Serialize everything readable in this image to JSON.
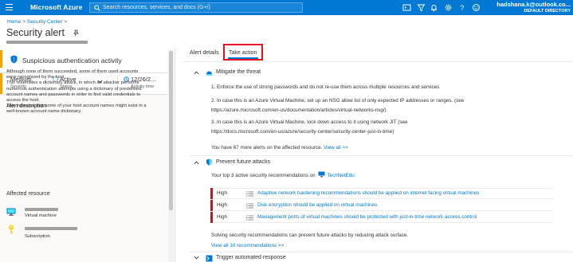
{
  "topbar": {
    "brand": "Microsoft Azure",
    "search_placeholder": "Search resources, services, and docs (G+/)",
    "user_email": "hadshana.k@outlook.co...",
    "user_directory": "DEFAULT DIRECTORY",
    "icons": [
      "cloud-shell-icon",
      "directory-filter-icon",
      "notifications-icon",
      "settings-icon",
      "help-icon",
      "feedback-icon"
    ],
    "bg_color": "#0078d4"
  },
  "breadcrumb": {
    "home": "Home",
    "sep": ">",
    "security_center": "Security Center",
    "sep2": ">"
  },
  "page": {
    "title": "Security alert"
  },
  "alert": {
    "name": "Suspicious authentication activity",
    "severity_value": "Medium",
    "severity_label": "Severity",
    "status_value": "Active",
    "status_label": "Status",
    "time_value": "12/26/2...",
    "time_label": "Activity time",
    "accent_color": "#f0a30a"
  },
  "description": {
    "heading": "Alert description",
    "lines": [
      "Although none of them succeeded, some of them used accounts",
      "were recognized by the host.",
      "This resembles a dictionary attack, in which an attacker performs",
      "numerous authentication attempts using a dictionary of predefined",
      "account names and passwords in order to find valid credentials to",
      "access the host.",
      "This indicates that some of your host account names might exist in a",
      "well-known account name dictionary."
    ]
  },
  "affected": {
    "heading": "Affected resource",
    "items": [
      {
        "type": "Virtual machine",
        "icon": "virtual-machine-icon"
      },
      {
        "type": "Subscription",
        "icon": "key-icon"
      }
    ]
  },
  "tabs": {
    "details": "Alert details",
    "take_action": "Take action"
  },
  "mitigate": {
    "title": "Mitigate the threat",
    "lines": [
      "1. Enforce the use of strong passwords and do not re-use them across multiple resources and services",
      "2. In case this is an Azure Virtual Machine, set up an NSG allow list of only expected IP addresses or ranges. (see",
      "https://azure.microsoft.com/en-us/documentation/articles/virtual-networks-nsg/)",
      "3. In case this is an Azure Virtual Machine, lock down access to it using network JIT (see",
      "https://docs.microsoft.com/en-us/azure/security-center/security-center-just-in-time)"
    ],
    "more_prefix": "You have 67 more alerts on the affected resource.",
    "more_link": "View all >>"
  },
  "prevent": {
    "title": "Prevent future attacks",
    "intro": "Your top 3 active security recommendations on",
    "resource_name": "TechNetEdu",
    "recommendations": [
      {
        "severity": "High",
        "name": "Adaptive network hardening recommendations should be applied on internet facing virtual machines"
      },
      {
        "severity": "High",
        "name": "Disk encryption should be applied on virtual machines"
      },
      {
        "severity": "High",
        "name": "Management ports of virtual machines should be protected with just-in-time network access control"
      }
    ],
    "footer": "Solving security recommendations can prevent future attacks by reducing attack surface.",
    "view_all": "View all 10 recommendations >>",
    "high_color": "#a4262c"
  },
  "trigger": {
    "title": "Trigger automated response"
  }
}
